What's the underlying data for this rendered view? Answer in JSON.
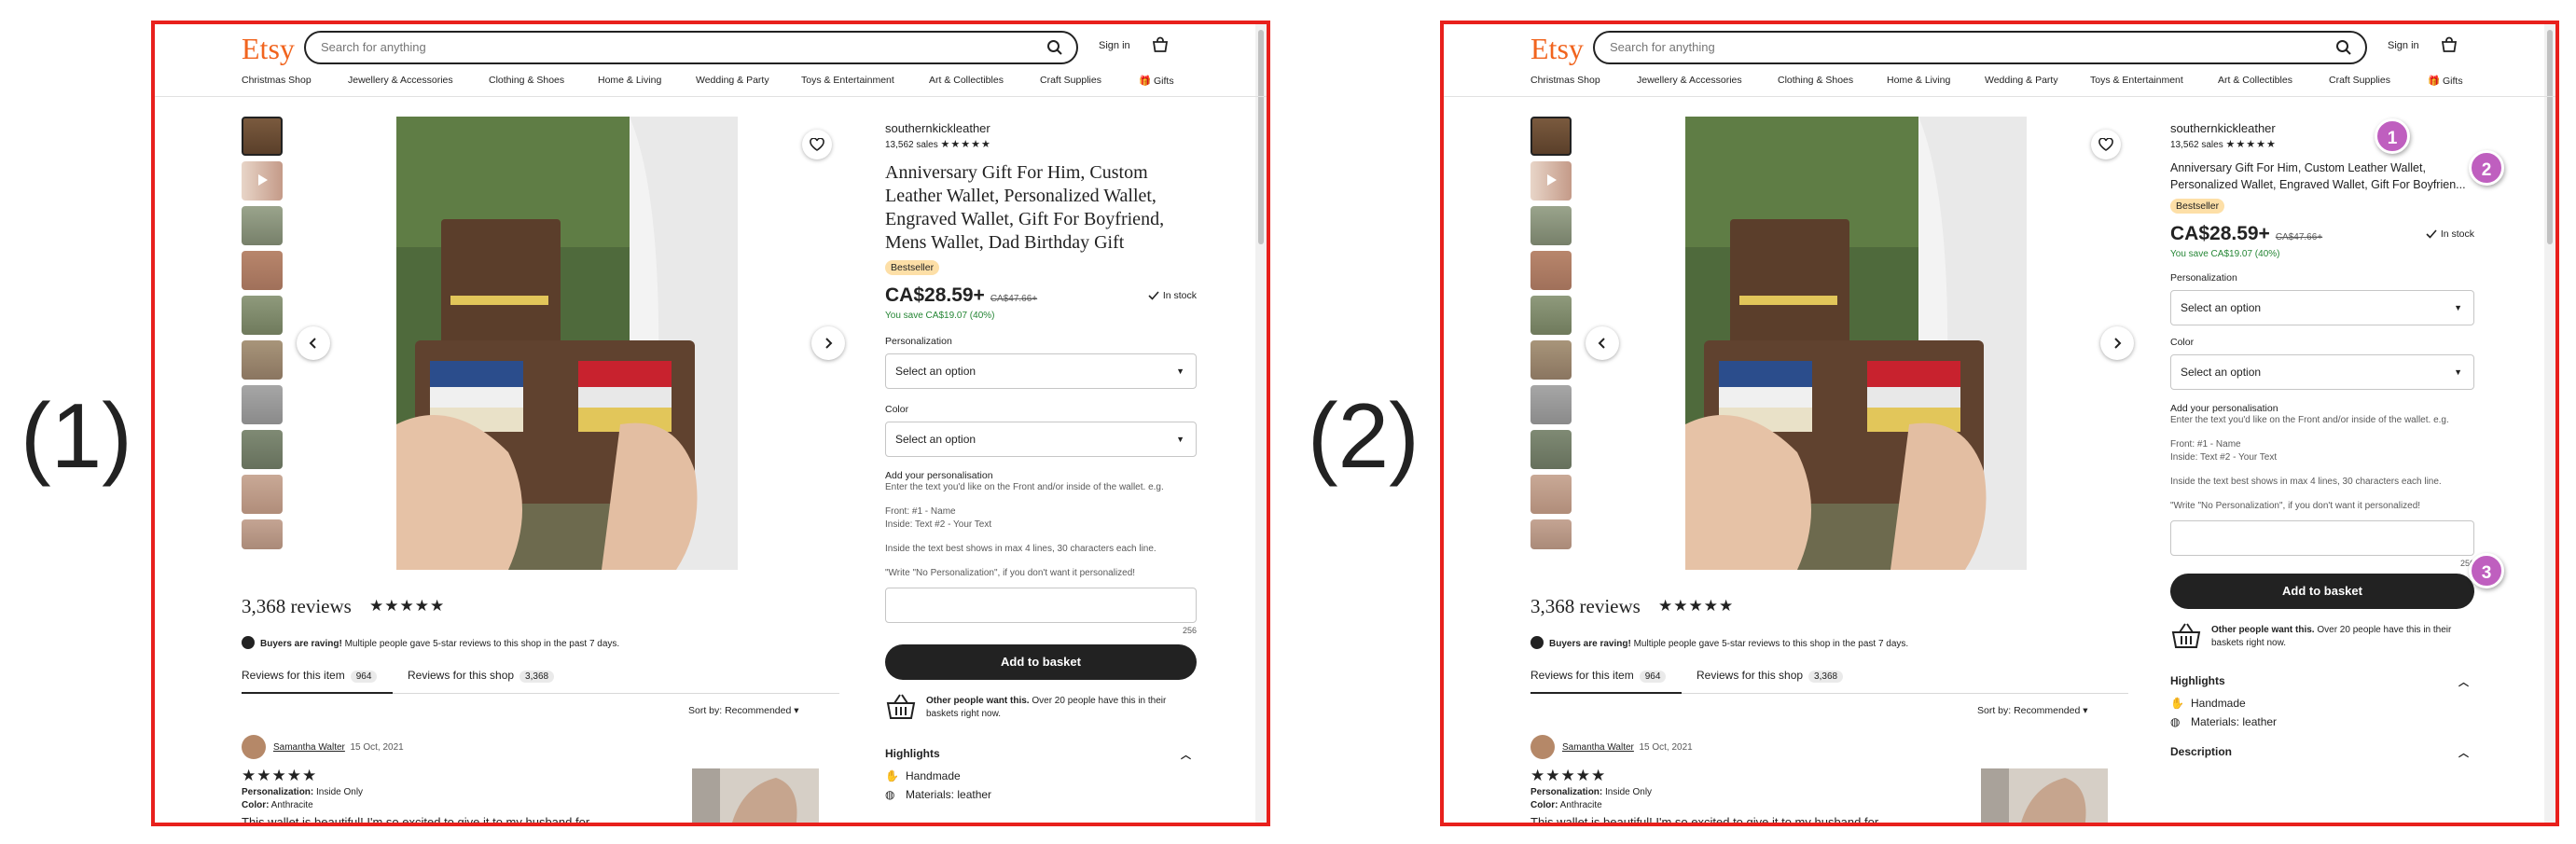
{
  "panels": [
    {
      "label": "(1)",
      "header": {
        "logo": "Etsy",
        "search_placeholder": "Search for anything",
        "signin": "Sign in",
        "nav": [
          "Christmas Shop",
          "Jewellery & Accessories",
          "Clothing & Shoes",
          "Home & Living",
          "Wedding & Party",
          "Toys & Entertainment",
          "Art & Collectibles",
          "Craft Supplies",
          "Gifts"
        ]
      },
      "listing": {
        "shop_name": "southernkickleather",
        "sales": "13,562 sales",
        "stars": "★★★★★",
        "title": "Anniversary Gift For Him, Custom Leather Wallet, Personalized Wallet, Engraved Wallet, Gift For Boyfriend, Mens Wallet, Dad Birthday Gift",
        "badge": "Bestseller",
        "price": "CA$28.59+",
        "old_price": "CA$47.66+",
        "stock": "In stock",
        "save": "You save CA$19.07 (40%)",
        "personalization_label": "Personalization",
        "personalization_select": "Select an option",
        "color_label": "Color",
        "color_select": "Select an option",
        "add_personal_label": "Add your personalisation",
        "add_personal_help": "Enter the text you'd like on the Front and/or inside of the wallet. e.g.",
        "example_front": "Front: #1 - Name",
        "example_inside": "Inside: Text #2 - Your Text",
        "lines_note": "Inside the text best shows in max 4 lines, 30 characters each line.",
        "no_personal_note": "\"Write \"No Personalization\", if you don't want it personalized!",
        "counter": "256",
        "add_to_basket": "Add to basket",
        "demand_bold": "Other people want this.",
        "demand_rest": " Over 20 people have this in their baskets right now.",
        "highlights": "Highlights",
        "highlight_1": "Handmade",
        "highlight_2": "Materials: leather"
      },
      "reviews": {
        "count_title": "3,368 reviews",
        "stars": "★★★★★",
        "raving_bold": "Buyers are raving!",
        "raving_rest": " Multiple people gave 5-star reviews to this shop in the past 7 days.",
        "tab_item": "Reviews for this item",
        "tab_item_count": "964",
        "tab_shop": "Reviews for this shop",
        "tab_shop_count": "3,368",
        "sort": "Sort by: Recommended",
        "reviewer": "Samantha Walter",
        "date": "15 Oct, 2021",
        "review_stars": "★★★★★",
        "meta_personal_key": "Personalization:",
        "meta_personal_val": " Inside Only",
        "meta_color_key": "Color:",
        "meta_color_val": " Anthracite",
        "text": "This wallet is beautiful! I'm so excited to give it to my husband for"
      }
    },
    {
      "label": "(2)",
      "header": {
        "logo": "Etsy",
        "search_placeholder": "Search for anything",
        "signin": "Sign in",
        "nav": [
          "Christmas Shop",
          "Jewellery & Accessories",
          "Clothing & Shoes",
          "Home & Living",
          "Wedding & Party",
          "Toys & Entertainment",
          "Art & Collectibles",
          "Craft Supplies",
          "Gifts"
        ]
      },
      "listing": {
        "shop_name": "southernkickleather",
        "sales": "13,562 sales",
        "stars": "★★★★★",
        "title": "Anniversary Gift For Him, Custom Leather Wallet, Personalized Wallet, Engraved Wallet, Gift For Boyfrien...",
        "badge": "Bestseller",
        "price": "CA$28.59+",
        "old_price": "CA$47.66+",
        "stock": "In stock",
        "save": "You save CA$19.07 (40%)",
        "personalization_label": "Personalization",
        "personalization_select": "Select an option",
        "color_label": "Color",
        "color_select": "Select an option",
        "add_personal_label": "Add your personalisation",
        "add_personal_help": "Enter the text you'd like on the Front and/or inside of the wallet. e.g.",
        "example_front": "Front: #1 - Name",
        "example_inside": "Inside: Text #2 - Your Text",
        "lines_note": "Inside the text best shows in max 4 lines, 30 characters each line.",
        "no_personal_note": "\"Write \"No Personalization\", if you don't want it personalized!",
        "counter": "256",
        "add_to_basket": "Add to basket",
        "demand_bold": "Other people want this.",
        "demand_rest": " Over 20 people have this in their baskets right now.",
        "highlights": "Highlights",
        "highlight_1": "Handmade",
        "highlight_2": "Materials: leather",
        "description": "Description"
      },
      "reviews": {
        "count_title": "3,368 reviews",
        "stars": "★★★★★",
        "raving_bold": "Buyers are raving!",
        "raving_rest": " Multiple people gave 5-star reviews to this shop in the past 7 days.",
        "tab_item": "Reviews for this item",
        "tab_item_count": "964",
        "tab_shop": "Reviews for this shop",
        "tab_shop_count": "3,368",
        "sort": "Sort by: Recommended",
        "reviewer": "Samantha Walter",
        "date": "15 Oct, 2021",
        "review_stars": "★★★★★",
        "meta_personal_key": "Personalization:",
        "meta_personal_val": " Inside Only",
        "meta_color_key": "Color:",
        "meta_color_val": " Anthracite",
        "text": "This wallet is beautiful! I'm so excited to give it to my husband for"
      },
      "markers": [
        "1",
        "2",
        "3"
      ]
    }
  ],
  "colors": {
    "frame": "#e8201c",
    "etsy_orange": "#f1641e",
    "badge": "#fddfa7",
    "save_green": "#258635",
    "marker": "#bf5fbf"
  }
}
